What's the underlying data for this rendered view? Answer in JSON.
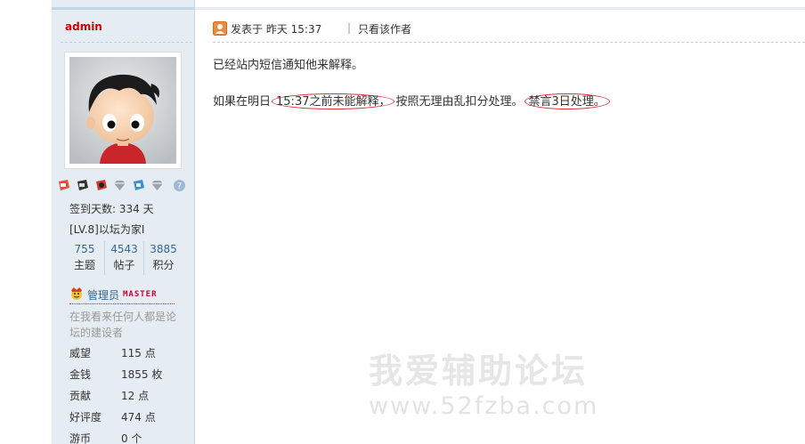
{
  "sidebar": {
    "username": "admin",
    "signin_days": "签到天数: 334 天",
    "level": "[LV.8]以坛为家I",
    "counts": [
      {
        "value": "755",
        "label": "主题"
      },
      {
        "value": "4543",
        "label": "帖子"
      },
      {
        "value": "3885",
        "label": "积分"
      }
    ],
    "group": {
      "name": "管理员",
      "tag": "MASTER"
    },
    "signature": "在我看来任何人都是论坛的建设者",
    "props": [
      {
        "label": "威望",
        "value": "115 点"
      },
      {
        "label": "金钱",
        "value": "1855 枚"
      },
      {
        "label": "贡献",
        "value": "12 点"
      },
      {
        "label": "好评度",
        "value": "474 点"
      },
      {
        "label": "游币",
        "value": "0 个"
      }
    ],
    "medal_icons": [
      "medal-1-icon",
      "medal-2-icon",
      "medal-3-icon",
      "diamond-medal-icon",
      "medal-5-icon",
      "diamond-medal-icon",
      "help-icon"
    ]
  },
  "post": {
    "posted_prefix": "发表于 昨天 15:37",
    "author_only": "只看该作者",
    "line1": "已经站内短信通知他来解释。",
    "line2_a": "如果在明日",
    "line2_b": "15:37之前未能解释，",
    "line2_c": "按照无理由乱扣分处理。",
    "line2_d": "禁言3日处理。"
  },
  "watermark": {
    "title": "我爱辅助论坛",
    "url": "www.52fzba.com"
  },
  "colors": {
    "sidebar_bg": "#e5edf2",
    "username": "#cc0000",
    "link": "#336699",
    "annotation_red": "#e0333d"
  }
}
